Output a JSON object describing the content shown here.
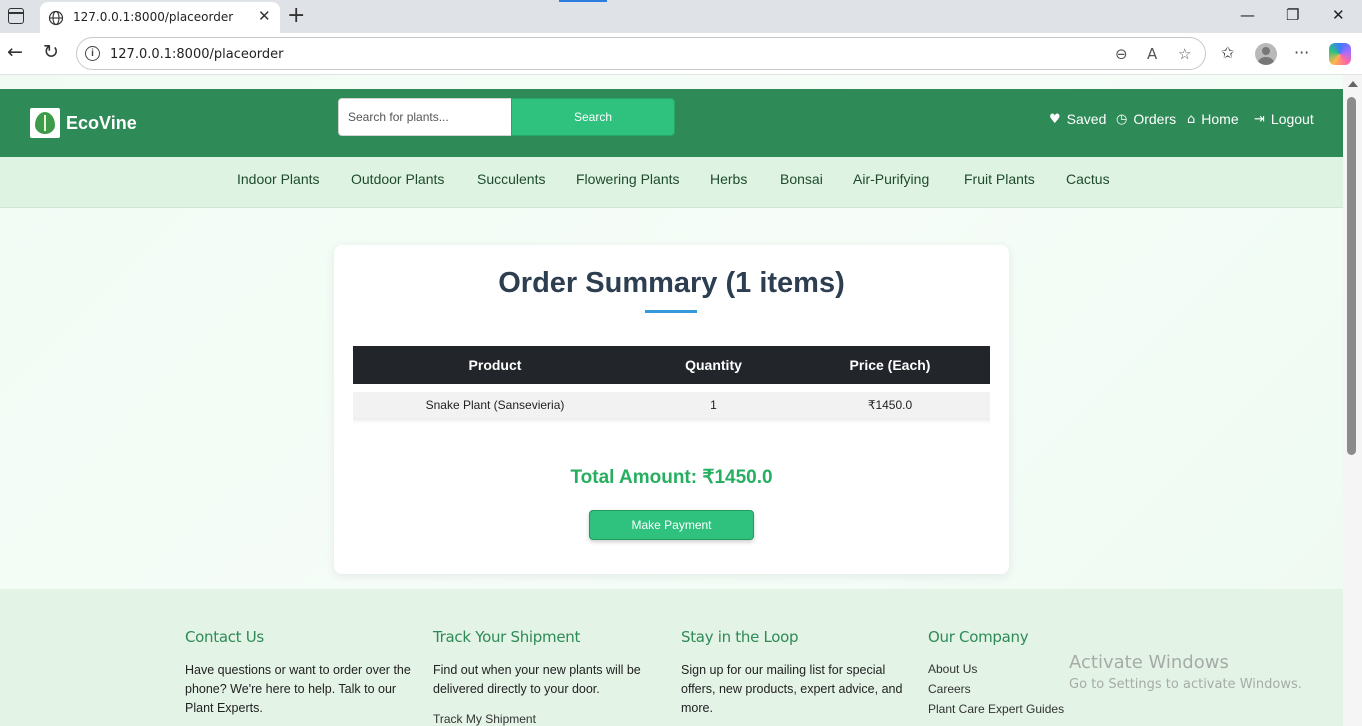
{
  "browser": {
    "tab_title": "127.0.0.1:8000/placeorder",
    "url": "127.0.0.1:8000/placeorder"
  },
  "header": {
    "brand": "EcoVine",
    "search_placeholder": "Search for plants...",
    "search_label": "Search",
    "nav": [
      {
        "label": "Saved",
        "icon": "heart-icon"
      },
      {
        "label": "Orders",
        "icon": "clock-icon"
      },
      {
        "label": "Home",
        "icon": "home-icon"
      },
      {
        "label": "Logout",
        "icon": "logout-icon"
      }
    ]
  },
  "categories": [
    "Indoor Plants",
    "Outdoor Plants",
    "Succulents",
    "Flowering Plants",
    "Herbs",
    "Bonsai",
    "Air-Purifying",
    "Fruit Plants",
    "Cactus"
  ],
  "order": {
    "title": "Order Summary (1 items)",
    "columns": [
      "Product",
      "Quantity",
      "Price (Each)"
    ],
    "rows": [
      {
        "product": "Snake Plant (Sansevieria)",
        "quantity": "1",
        "price": "₹1450.0"
      }
    ],
    "total": "Total Amount: ₹1450.0",
    "pay_label": "Make Payment"
  },
  "footer": {
    "contact": {
      "title": "Contact Us",
      "text": "Have questions or want to order over the phone? We're here to help. Talk to our Plant Experts."
    },
    "track": {
      "title": "Track Your Shipment",
      "text": "Find out when your new plants will be delivered directly to your door.",
      "link": "Track My Shipment"
    },
    "loop": {
      "title": "Stay in the Loop",
      "text": "Sign up for our mailing list for special offers, new products, expert advice, and more."
    },
    "company": {
      "title": "Our Company",
      "links": [
        "About Us",
        "Careers",
        "Plant Care Expert Guides"
      ]
    }
  },
  "watermark": {
    "line1": "Activate Windows",
    "line2": "Go to Settings to activate Windows."
  },
  "colors": {
    "brand_green": "#2e8b57",
    "button_green": "#2ec27e",
    "total_green": "#27ae60",
    "title_navy": "#2c3e50"
  }
}
